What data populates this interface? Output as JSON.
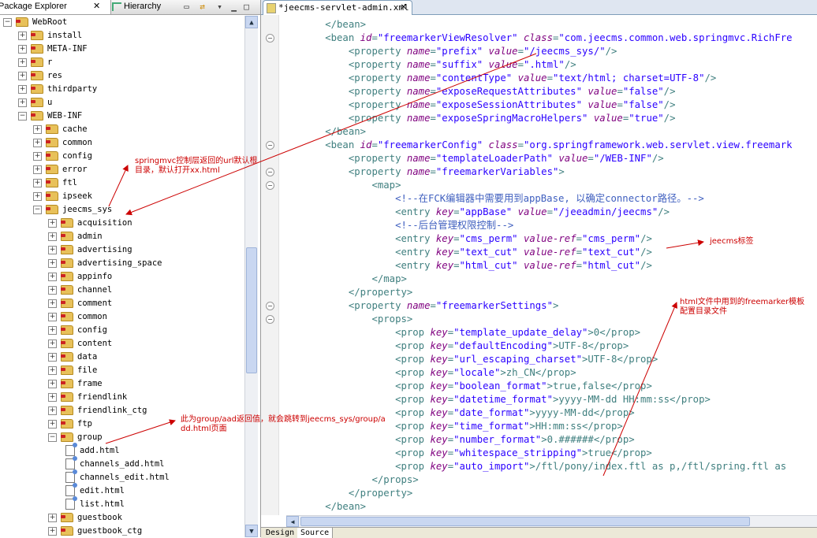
{
  "left_panel": {
    "tab_package_explorer": "Package Explorer",
    "tab_hierarchy": "Hierarchy",
    "tree": [
      {
        "label": "WebRoot",
        "type": "folder",
        "exp": "−",
        "indent": 0
      },
      {
        "label": "install",
        "type": "folder",
        "exp": "+",
        "indent": 1
      },
      {
        "label": "META-INF",
        "type": "folder",
        "exp": "+",
        "indent": 1
      },
      {
        "label": "r",
        "type": "folder",
        "exp": "+",
        "indent": 1
      },
      {
        "label": "res",
        "type": "folder",
        "exp": "+",
        "indent": 1
      },
      {
        "label": "thirdparty",
        "type": "folder",
        "exp": "+",
        "indent": 1
      },
      {
        "label": "u",
        "type": "folder",
        "exp": "+",
        "indent": 1
      },
      {
        "label": "WEB-INF",
        "type": "folder",
        "exp": "−",
        "indent": 1
      },
      {
        "label": "cache",
        "type": "folder",
        "exp": "+",
        "indent": 2
      },
      {
        "label": "common",
        "type": "folder",
        "exp": "+",
        "indent": 2
      },
      {
        "label": "config",
        "type": "folder",
        "exp": "+",
        "indent": 2
      },
      {
        "label": "error",
        "type": "folder",
        "exp": "+",
        "indent": 2
      },
      {
        "label": "ftl",
        "type": "folder",
        "exp": "+",
        "indent": 2
      },
      {
        "label": "ipseek",
        "type": "folder",
        "exp": "+",
        "indent": 2
      },
      {
        "label": "jeecms_sys",
        "type": "folder",
        "exp": "−",
        "indent": 2
      },
      {
        "label": "acquisition",
        "type": "folder",
        "exp": "+",
        "indent": 3
      },
      {
        "label": "admin",
        "type": "folder",
        "exp": "+",
        "indent": 3
      },
      {
        "label": "advertising",
        "type": "folder",
        "exp": "+",
        "indent": 3
      },
      {
        "label": "advertising_space",
        "type": "folder",
        "exp": "+",
        "indent": 3
      },
      {
        "label": "appinfo",
        "type": "folder",
        "exp": "+",
        "indent": 3
      },
      {
        "label": "channel",
        "type": "folder",
        "exp": "+",
        "indent": 3
      },
      {
        "label": "comment",
        "type": "folder",
        "exp": "+",
        "indent": 3
      },
      {
        "label": "common",
        "type": "folder",
        "exp": "+",
        "indent": 3
      },
      {
        "label": "config",
        "type": "folder",
        "exp": "+",
        "indent": 3
      },
      {
        "label": "content",
        "type": "folder",
        "exp": "+",
        "indent": 3
      },
      {
        "label": "data",
        "type": "folder",
        "exp": "+",
        "indent": 3
      },
      {
        "label": "file",
        "type": "folder",
        "exp": "+",
        "indent": 3
      },
      {
        "label": "frame",
        "type": "folder",
        "exp": "+",
        "indent": 3
      },
      {
        "label": "friendlink",
        "type": "folder",
        "exp": "+",
        "indent": 3
      },
      {
        "label": "friendlink_ctg",
        "type": "folder",
        "exp": "+",
        "indent": 3
      },
      {
        "label": "ftp",
        "type": "folder",
        "exp": "+",
        "indent": 3
      },
      {
        "label": "group",
        "type": "folder",
        "exp": "−",
        "indent": 3
      },
      {
        "label": "add.html",
        "type": "file",
        "exp": "",
        "indent": 4
      },
      {
        "label": "channels_add.html",
        "type": "file",
        "exp": "",
        "indent": 4
      },
      {
        "label": "channels_edit.html",
        "type": "file",
        "exp": "",
        "indent": 4
      },
      {
        "label": "edit.html",
        "type": "file",
        "exp": "",
        "indent": 4
      },
      {
        "label": "list.html",
        "type": "file",
        "exp": "",
        "indent": 4
      },
      {
        "label": "guestbook",
        "type": "folder",
        "exp": "+",
        "indent": 3
      },
      {
        "label": "guestbook_ctg",
        "type": "folder",
        "exp": "+",
        "indent": 3
      }
    ]
  },
  "editor": {
    "tab_title": "*jeecms-servlet-admin.xml",
    "lines": [
      [
        [
          "t",
          "        </bean>"
        ]
      ],
      [
        [
          "t",
          "        <bean "
        ],
        [
          "a",
          "id"
        ],
        [
          "t",
          "="
        ],
        [
          "v",
          "\"freemarkerViewResolver\""
        ],
        [
          "t",
          " "
        ],
        [
          "a",
          "class"
        ],
        [
          "t",
          "="
        ],
        [
          "v",
          "\"com.jeecms.common.web.springmvc.RichFre"
        ]
      ],
      [
        [
          "t",
          "            <property "
        ],
        [
          "a",
          "name"
        ],
        [
          "t",
          "="
        ],
        [
          "v",
          "\"prefix\""
        ],
        [
          "t",
          " "
        ],
        [
          "a",
          "value"
        ],
        [
          "t",
          "="
        ],
        [
          "v",
          "\"/jeecms_sys/\""
        ],
        [
          "t",
          "/>"
        ]
      ],
      [
        [
          "t",
          "            <property "
        ],
        [
          "a",
          "name"
        ],
        [
          "t",
          "="
        ],
        [
          "v",
          "\"suffix\""
        ],
        [
          "t",
          " "
        ],
        [
          "a",
          "value"
        ],
        [
          "t",
          "="
        ],
        [
          "v",
          "\".html\""
        ],
        [
          "t",
          "/>"
        ]
      ],
      [
        [
          "t",
          "            <property "
        ],
        [
          "a",
          "name"
        ],
        [
          "t",
          "="
        ],
        [
          "v",
          "\"contentType\""
        ],
        [
          "t",
          " "
        ],
        [
          "a",
          "value"
        ],
        [
          "t",
          "="
        ],
        [
          "v",
          "\"text/html; charset=UTF-8\""
        ],
        [
          "t",
          "/>"
        ]
      ],
      [
        [
          "t",
          "            <property "
        ],
        [
          "a",
          "name"
        ],
        [
          "t",
          "="
        ],
        [
          "v",
          "\"exposeRequestAttributes\""
        ],
        [
          "t",
          " "
        ],
        [
          "a",
          "value"
        ],
        [
          "t",
          "="
        ],
        [
          "v",
          "\"false\""
        ],
        [
          "t",
          "/>"
        ]
      ],
      [
        [
          "t",
          "            <property "
        ],
        [
          "a",
          "name"
        ],
        [
          "t",
          "="
        ],
        [
          "v",
          "\"exposeSessionAttributes\""
        ],
        [
          "t",
          " "
        ],
        [
          "a",
          "value"
        ],
        [
          "t",
          "="
        ],
        [
          "v",
          "\"false\""
        ],
        [
          "t",
          "/>"
        ]
      ],
      [
        [
          "t",
          "            <property "
        ],
        [
          "a",
          "name"
        ],
        [
          "t",
          "="
        ],
        [
          "v",
          "\"exposeSpringMacroHelpers\""
        ],
        [
          "t",
          " "
        ],
        [
          "a",
          "value"
        ],
        [
          "t",
          "="
        ],
        [
          "v",
          "\"true\""
        ],
        [
          "t",
          "/>"
        ]
      ],
      [
        [
          "t",
          "        </bean>"
        ]
      ],
      [
        [
          "t",
          "        <bean "
        ],
        [
          "a",
          "id"
        ],
        [
          "t",
          "="
        ],
        [
          "v",
          "\"freemarkerConfig\""
        ],
        [
          "t",
          " "
        ],
        [
          "a",
          "class"
        ],
        [
          "t",
          "="
        ],
        [
          "v",
          "\"org.springframework.web.servlet.view.freemark"
        ]
      ],
      [
        [
          "t",
          "            <property "
        ],
        [
          "a",
          "name"
        ],
        [
          "t",
          "="
        ],
        [
          "v",
          "\"templateLoaderPath\""
        ],
        [
          "t",
          " "
        ],
        [
          "a",
          "value"
        ],
        [
          "t",
          "="
        ],
        [
          "v",
          "\"/WEB-INF\""
        ],
        [
          "t",
          "/>"
        ]
      ],
      [
        [
          "t",
          "            <property "
        ],
        [
          "a",
          "name"
        ],
        [
          "t",
          "="
        ],
        [
          "v",
          "\"freemarkerVariables\""
        ],
        [
          "t",
          ">"
        ]
      ],
      [
        [
          "t",
          "                <map>"
        ]
      ],
      [
        [
          "c",
          "                    <!--在FCK编辑器中需要用到appBase, 以确定connector路径。-->"
        ]
      ],
      [
        [
          "t",
          "                    <entry "
        ],
        [
          "a",
          "key"
        ],
        [
          "t",
          "="
        ],
        [
          "v",
          "\"appBase\""
        ],
        [
          "t",
          " "
        ],
        [
          "a",
          "value"
        ],
        [
          "t",
          "="
        ],
        [
          "v",
          "\"/jeeadmin/jeecms\""
        ],
        [
          "t",
          "/>"
        ]
      ],
      [
        [
          "c",
          "                    <!--后台管理权限控制-->"
        ]
      ],
      [
        [
          "t",
          "                    <entry "
        ],
        [
          "a",
          "key"
        ],
        [
          "t",
          "="
        ],
        [
          "v",
          "\"cms_perm\""
        ],
        [
          "t",
          " "
        ],
        [
          "a",
          "value-ref"
        ],
        [
          "t",
          "="
        ],
        [
          "v",
          "\"cms_perm\""
        ],
        [
          "t",
          "/>"
        ]
      ],
      [
        [
          "t",
          "                    <entry "
        ],
        [
          "a",
          "key"
        ],
        [
          "t",
          "="
        ],
        [
          "v",
          "\"text_cut\""
        ],
        [
          "t",
          " "
        ],
        [
          "a",
          "value-ref"
        ],
        [
          "t",
          "="
        ],
        [
          "v",
          "\"text_cut\""
        ],
        [
          "t",
          "/>"
        ]
      ],
      [
        [
          "t",
          "                    <entry "
        ],
        [
          "a",
          "key"
        ],
        [
          "t",
          "="
        ],
        [
          "v",
          "\"html_cut\""
        ],
        [
          "t",
          " "
        ],
        [
          "a",
          "value-ref"
        ],
        [
          "t",
          "="
        ],
        [
          "v",
          "\"html_cut\""
        ],
        [
          "t",
          "/>"
        ]
      ],
      [
        [
          "t",
          "                </map>"
        ]
      ],
      [
        [
          "t",
          "            </property>"
        ]
      ],
      [
        [
          "t",
          "            <property "
        ],
        [
          "a",
          "name"
        ],
        [
          "t",
          "="
        ],
        [
          "v",
          "\"freemarkerSettings\""
        ],
        [
          "t",
          ">"
        ]
      ],
      [
        [
          "t",
          "                <props>"
        ]
      ],
      [
        [
          "t",
          "                    <prop "
        ],
        [
          "a",
          "key"
        ],
        [
          "t",
          "="
        ],
        [
          "v",
          "\"template_update_delay\""
        ],
        [
          "t",
          ">0</prop>"
        ]
      ],
      [
        [
          "t",
          "                    <prop "
        ],
        [
          "a",
          "key"
        ],
        [
          "t",
          "="
        ],
        [
          "v",
          "\"defaultEncoding\""
        ],
        [
          "t",
          ">UTF-8</prop>"
        ]
      ],
      [
        [
          "t",
          "                    <prop "
        ],
        [
          "a",
          "key"
        ],
        [
          "t",
          "="
        ],
        [
          "v",
          "\"url_escaping_charset\""
        ],
        [
          "t",
          ">UTF-8</prop>"
        ]
      ],
      [
        [
          "t",
          "                    <prop "
        ],
        [
          "a",
          "key"
        ],
        [
          "t",
          "="
        ],
        [
          "v",
          "\"locale\""
        ],
        [
          "t",
          ">zh_CN</prop>"
        ]
      ],
      [
        [
          "t",
          "                    <prop "
        ],
        [
          "a",
          "key"
        ],
        [
          "t",
          "="
        ],
        [
          "v",
          "\"boolean_format\""
        ],
        [
          "t",
          ">true,false</prop>"
        ]
      ],
      [
        [
          "t",
          "                    <prop "
        ],
        [
          "a",
          "key"
        ],
        [
          "t",
          "="
        ],
        [
          "v",
          "\"datetime_format\""
        ],
        [
          "t",
          ">yyyy-MM-dd HH:mm:ss</prop>"
        ]
      ],
      [
        [
          "t",
          "                    <prop "
        ],
        [
          "a",
          "key"
        ],
        [
          "t",
          "="
        ],
        [
          "v",
          "\"date_format\""
        ],
        [
          "t",
          ">yyyy-MM-dd</prop>"
        ]
      ],
      [
        [
          "t",
          "                    <prop "
        ],
        [
          "a",
          "key"
        ],
        [
          "t",
          "="
        ],
        [
          "v",
          "\"time_format\""
        ],
        [
          "t",
          ">HH:mm:ss</prop>"
        ]
      ],
      [
        [
          "t",
          "                    <prop "
        ],
        [
          "a",
          "key"
        ],
        [
          "t",
          "="
        ],
        [
          "v",
          "\"number_format\""
        ],
        [
          "t",
          ">0.######</prop>"
        ]
      ],
      [
        [
          "t",
          "                    <prop "
        ],
        [
          "a",
          "key"
        ],
        [
          "t",
          "="
        ],
        [
          "v",
          "\"whitespace_stripping\""
        ],
        [
          "t",
          ">true</prop>"
        ]
      ],
      [
        [
          "t",
          "                    <prop "
        ],
        [
          "a",
          "key"
        ],
        [
          "t",
          "="
        ],
        [
          "v",
          "\"auto_import\""
        ],
        [
          "t",
          ">/ftl/pony/index.ftl as p,/ftl/spring.ftl as"
        ]
      ],
      [
        [
          "t",
          "                </props>"
        ]
      ],
      [
        [
          "t",
          "            </property>"
        ]
      ],
      [
        [
          "t",
          "        </bean>"
        ]
      ]
    ],
    "bottom_tab_design": "Design",
    "bottom_tab_source": "Source"
  },
  "annotations": {
    "note_springmvc": "springmvc控制层返回的url默认根目录，默认打开xx.html",
    "note_jeecms_tag": "jeecms标签",
    "note_html_freemarker": "html文件中用到的freemarker模板配置目录文件",
    "note_group": "此为group/aad返回值，就会跳转到jeecms_sys/group/add.html页面",
    "annotation_color": "#cc0000"
  }
}
